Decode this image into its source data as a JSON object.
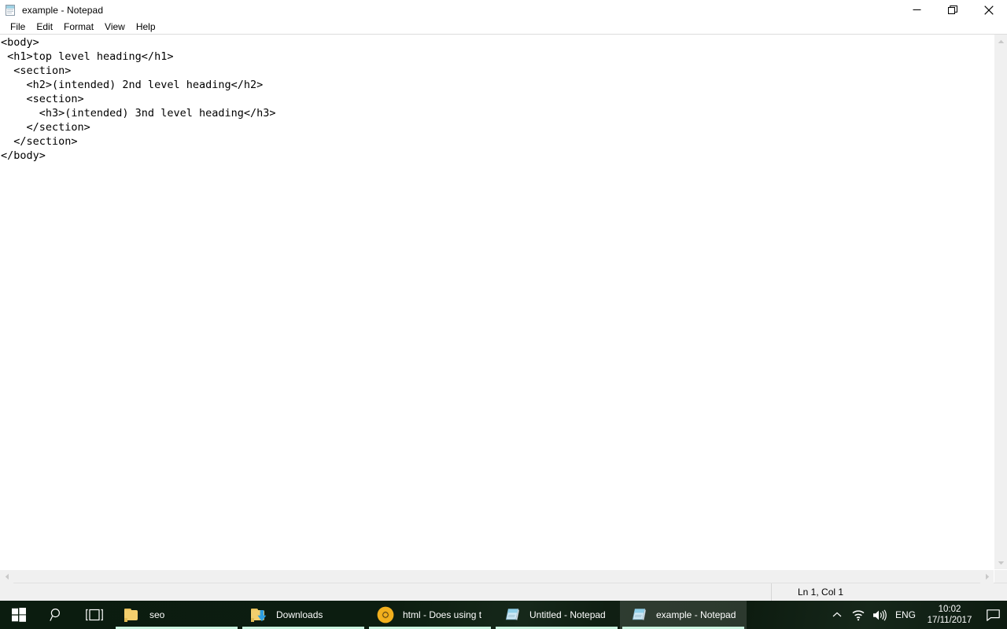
{
  "window": {
    "title": "example - Notepad",
    "icon": "notepad-icon",
    "menus": [
      "File",
      "Edit",
      "Format",
      "View",
      "Help"
    ],
    "controls": {
      "minimize": "Minimize",
      "restore": "Restore Down",
      "close": "Close"
    },
    "editor": {
      "lines": [
        "<body>",
        " <h1>top level heading</h1>",
        "  <section>",
        "    <h2>(intended) 2nd level heading</h2>",
        "    <section>",
        "      <h3>(intended) 3nd level heading</h3>",
        "    </section>",
        "  </section>",
        "</body>"
      ],
      "text": "<body>\n <h1>top level heading</h1>\n  <section>\n    <h2>(intended) 2nd level heading</h2>\n    <section>\n      <h3>(intended) 3nd level heading</h3>\n    </section>\n  </section>\n</body>"
    },
    "statusbar": {
      "position": "Ln 1, Col 1"
    },
    "scrollbars": {
      "up_arrow": "scroll-up-icon",
      "down_arrow": "scroll-down-icon",
      "left_arrow": "scroll-left-icon",
      "right_arrow": "scroll-right-icon"
    }
  },
  "taskbar": {
    "start": "start-button",
    "search": "search-icon",
    "taskview": "task-view-icon",
    "items": [
      {
        "label": "seo",
        "icon": "folder-icon",
        "active": false,
        "open": true
      },
      {
        "label": "Downloads",
        "icon": "downloads-folder-icon",
        "active": false,
        "open": true
      },
      {
        "label": "html - Does using t...",
        "icon": "chrome-icon",
        "active": false,
        "open": true
      },
      {
        "label": "Untitled - Notepad",
        "icon": "notepad-icon",
        "active": false,
        "open": true
      },
      {
        "label": "example - Notepad",
        "icon": "notepad-icon",
        "active": true,
        "open": true
      }
    ],
    "tray": {
      "overflow": "chevron-up-icon",
      "network": "wifi-icon",
      "volume": "volume-icon",
      "language": "ENG",
      "time": "10:02",
      "date": "17/11/2017",
      "action_center": "action-center-icon"
    }
  },
  "colors": {
    "taskbar_bg": "#0d1c10",
    "accent_underline": "#c9f3df",
    "window_bg": "#ffffff",
    "scrollbar_bg": "#f0f0f0",
    "statusbar_bg": "#f0f0f0",
    "text": "#000000",
    "folder_yellow": "#f3cf6d",
    "chrome_yellow": "#f2b01e"
  }
}
